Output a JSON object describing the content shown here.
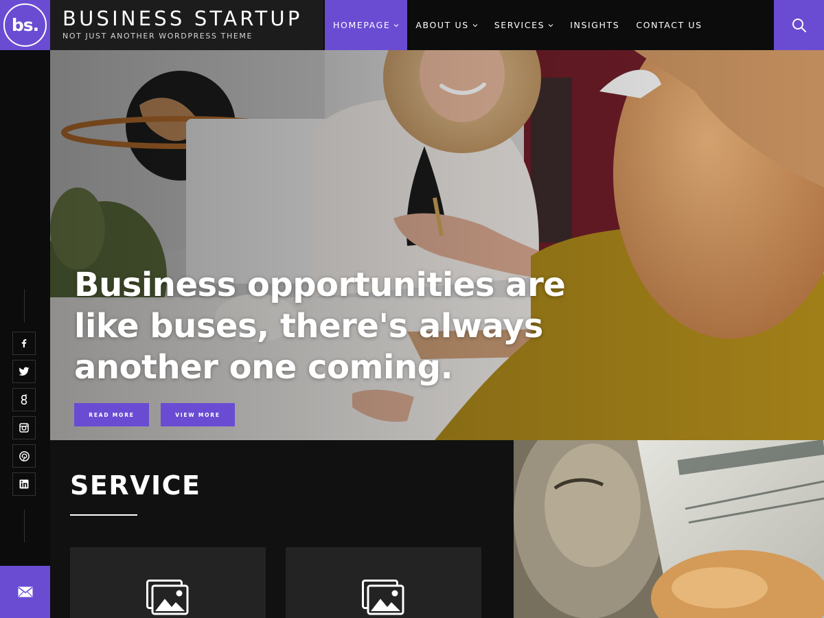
{
  "brand": {
    "logo_text": "bs.",
    "title": "BUSINESS STARTUP",
    "tagline": "NOT JUST ANOTHER WORDPRESS THEME",
    "accent_color": "#6a4cd3"
  },
  "nav": {
    "items": [
      {
        "label": "HOMEPAGE",
        "active": true,
        "has_dropdown": true
      },
      {
        "label": "ABOUT US",
        "active": false,
        "has_dropdown": true
      },
      {
        "label": "SERVICES",
        "active": false,
        "has_dropdown": true
      },
      {
        "label": "INSIGHTS",
        "active": false,
        "has_dropdown": false
      },
      {
        "label": "CONTACT US",
        "active": false,
        "has_dropdown": false
      }
    ],
    "search_icon": "search-icon"
  },
  "social": {
    "icons": [
      "facebook-icon",
      "twitter-icon",
      "google-plus-icon",
      "instagram-icon",
      "pinterest-icon",
      "linkedin-icon"
    ],
    "mail_icon": "mail-icon"
  },
  "hero": {
    "title": "Business opportunities are like buses, there's always another one coming.",
    "buttons": {
      "read_more": "READ MORE",
      "view_more": "VIEW MORE"
    }
  },
  "service": {
    "heading": "SERVICE",
    "card_icon": "image-placeholder-icon"
  }
}
